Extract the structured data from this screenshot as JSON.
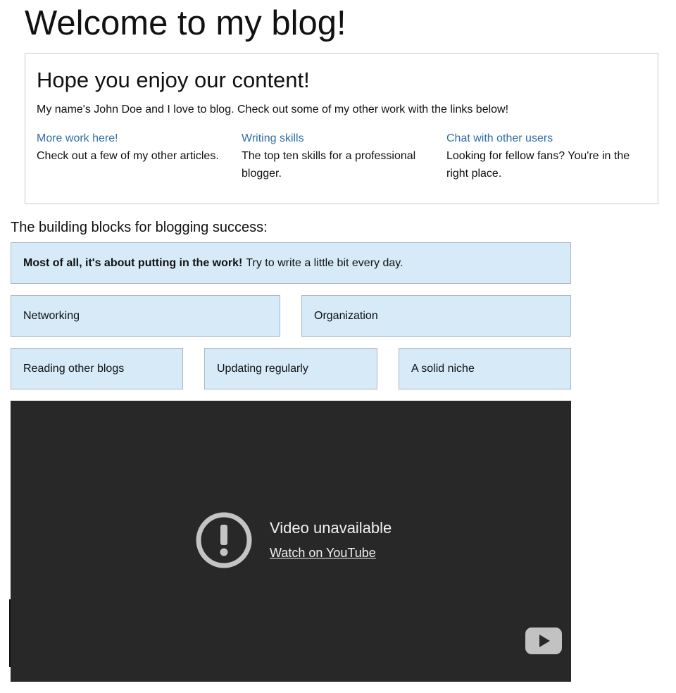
{
  "page": {
    "title": "Welcome to my blog!"
  },
  "hero": {
    "heading": "Hope you enjoy our content!",
    "intro": "My name's John Doe and I love to blog. Check out some of my other work with the links below!",
    "links": [
      {
        "label": "More work here!",
        "description": "Check out a few of my other articles."
      },
      {
        "label": "Writing skills",
        "description": "The top ten skills for a professional blogger."
      },
      {
        "label": "Chat with other users",
        "description": "Looking for fellow fans? You're in the right place."
      }
    ]
  },
  "blocks": {
    "intro": "The building blocks for blogging success:",
    "highlight_bold": "Most of all, it's about putting in the work!",
    "highlight_text": "Try to write a little bit every day.",
    "items": [
      "Networking",
      "Organization",
      "Reading other blogs",
      "Updating regularly",
      "A solid niche"
    ]
  },
  "video": {
    "status": "Video unavailable",
    "link_label": "Watch on YouTube",
    "icons": [
      "alert-circle-icon",
      "youtube-play-icon"
    ]
  },
  "colors": {
    "link": "#2f6fa8",
    "block_background": "#d6eaf8",
    "block_border": "#a8b8c4",
    "video_background": "#282828"
  }
}
